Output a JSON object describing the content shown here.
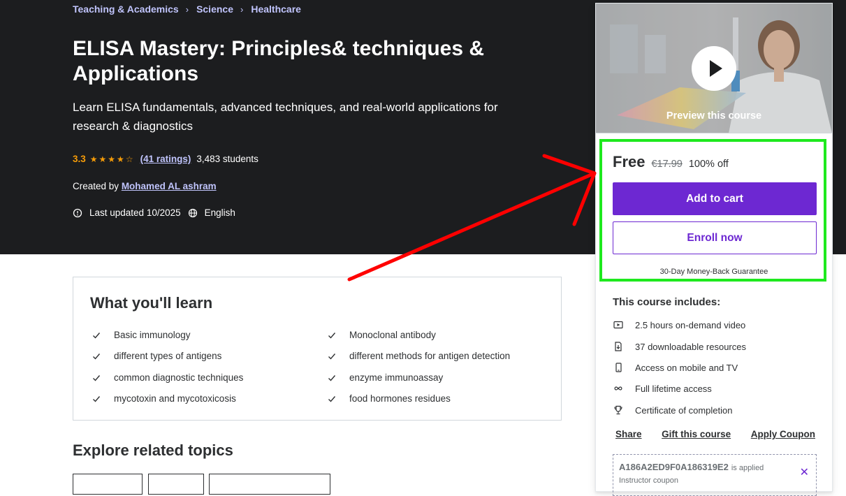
{
  "breadcrumb": {
    "items": [
      "Teaching & Academics",
      "Science",
      "Healthcare"
    ],
    "separator": "›"
  },
  "course": {
    "title": "ELISA Mastery: Principles& techniques & Applications",
    "subtitle": "Learn ELISA fundamentals, advanced techniques, and real-world applications for research & diagnostics",
    "rating": "3.3",
    "stars": "★★★★☆",
    "rating_fraction": 0.66,
    "ratings_count": "(41 ratings)",
    "students": "3,483 students",
    "created_by_label": "Created by",
    "instructor": "Mohamed AL ashram",
    "last_updated": "Last updated 10/2025",
    "language": "English"
  },
  "learn": {
    "title": "What you'll learn",
    "left_items": [
      "Basic immunology",
      "different types of antigens",
      "common diagnostic techniques",
      "mycotoxin and mycotoxicosis"
    ],
    "right_items": [
      "Monoclonal antibody",
      "different methods for antigen detection",
      "enzyme immunoassay",
      "food hormones residues"
    ]
  },
  "related": {
    "title": "Explore related topics"
  },
  "sidebar": {
    "preview_label": "Preview this course",
    "price_free": "Free",
    "price_original": "€17.99",
    "discount": "100% off",
    "add_to_cart": "Add to cart",
    "enroll_now": "Enroll now",
    "guarantee": "30-Day Money-Back Guarantee",
    "includes_title": "This course includes:",
    "includes": [
      {
        "icon": "video-icon",
        "text": "2.5 hours on-demand video"
      },
      {
        "icon": "download-file-icon",
        "text": "37 downloadable resources"
      },
      {
        "icon": "mobile-icon",
        "text": "Access on mobile and TV"
      },
      {
        "icon": "infinity-icon",
        "text": "Full lifetime access"
      },
      {
        "icon": "trophy-icon",
        "text": "Certificate of completion"
      }
    ],
    "share": "Share",
    "gift": "Gift this course",
    "apply_coupon": "Apply Coupon",
    "coupon_code": "A186A2ED9F0A186319E2",
    "coupon_applied": "is applied",
    "coupon_type": "Instructor coupon"
  },
  "colors": {
    "hero_bg": "#1c1d1f",
    "accent_purple": "#6d28d2",
    "link_lavender": "#c0c4fc",
    "star_orange": "#f69c08",
    "annotation_green": "#1ee91e",
    "annotation_red": "#ff0000"
  }
}
